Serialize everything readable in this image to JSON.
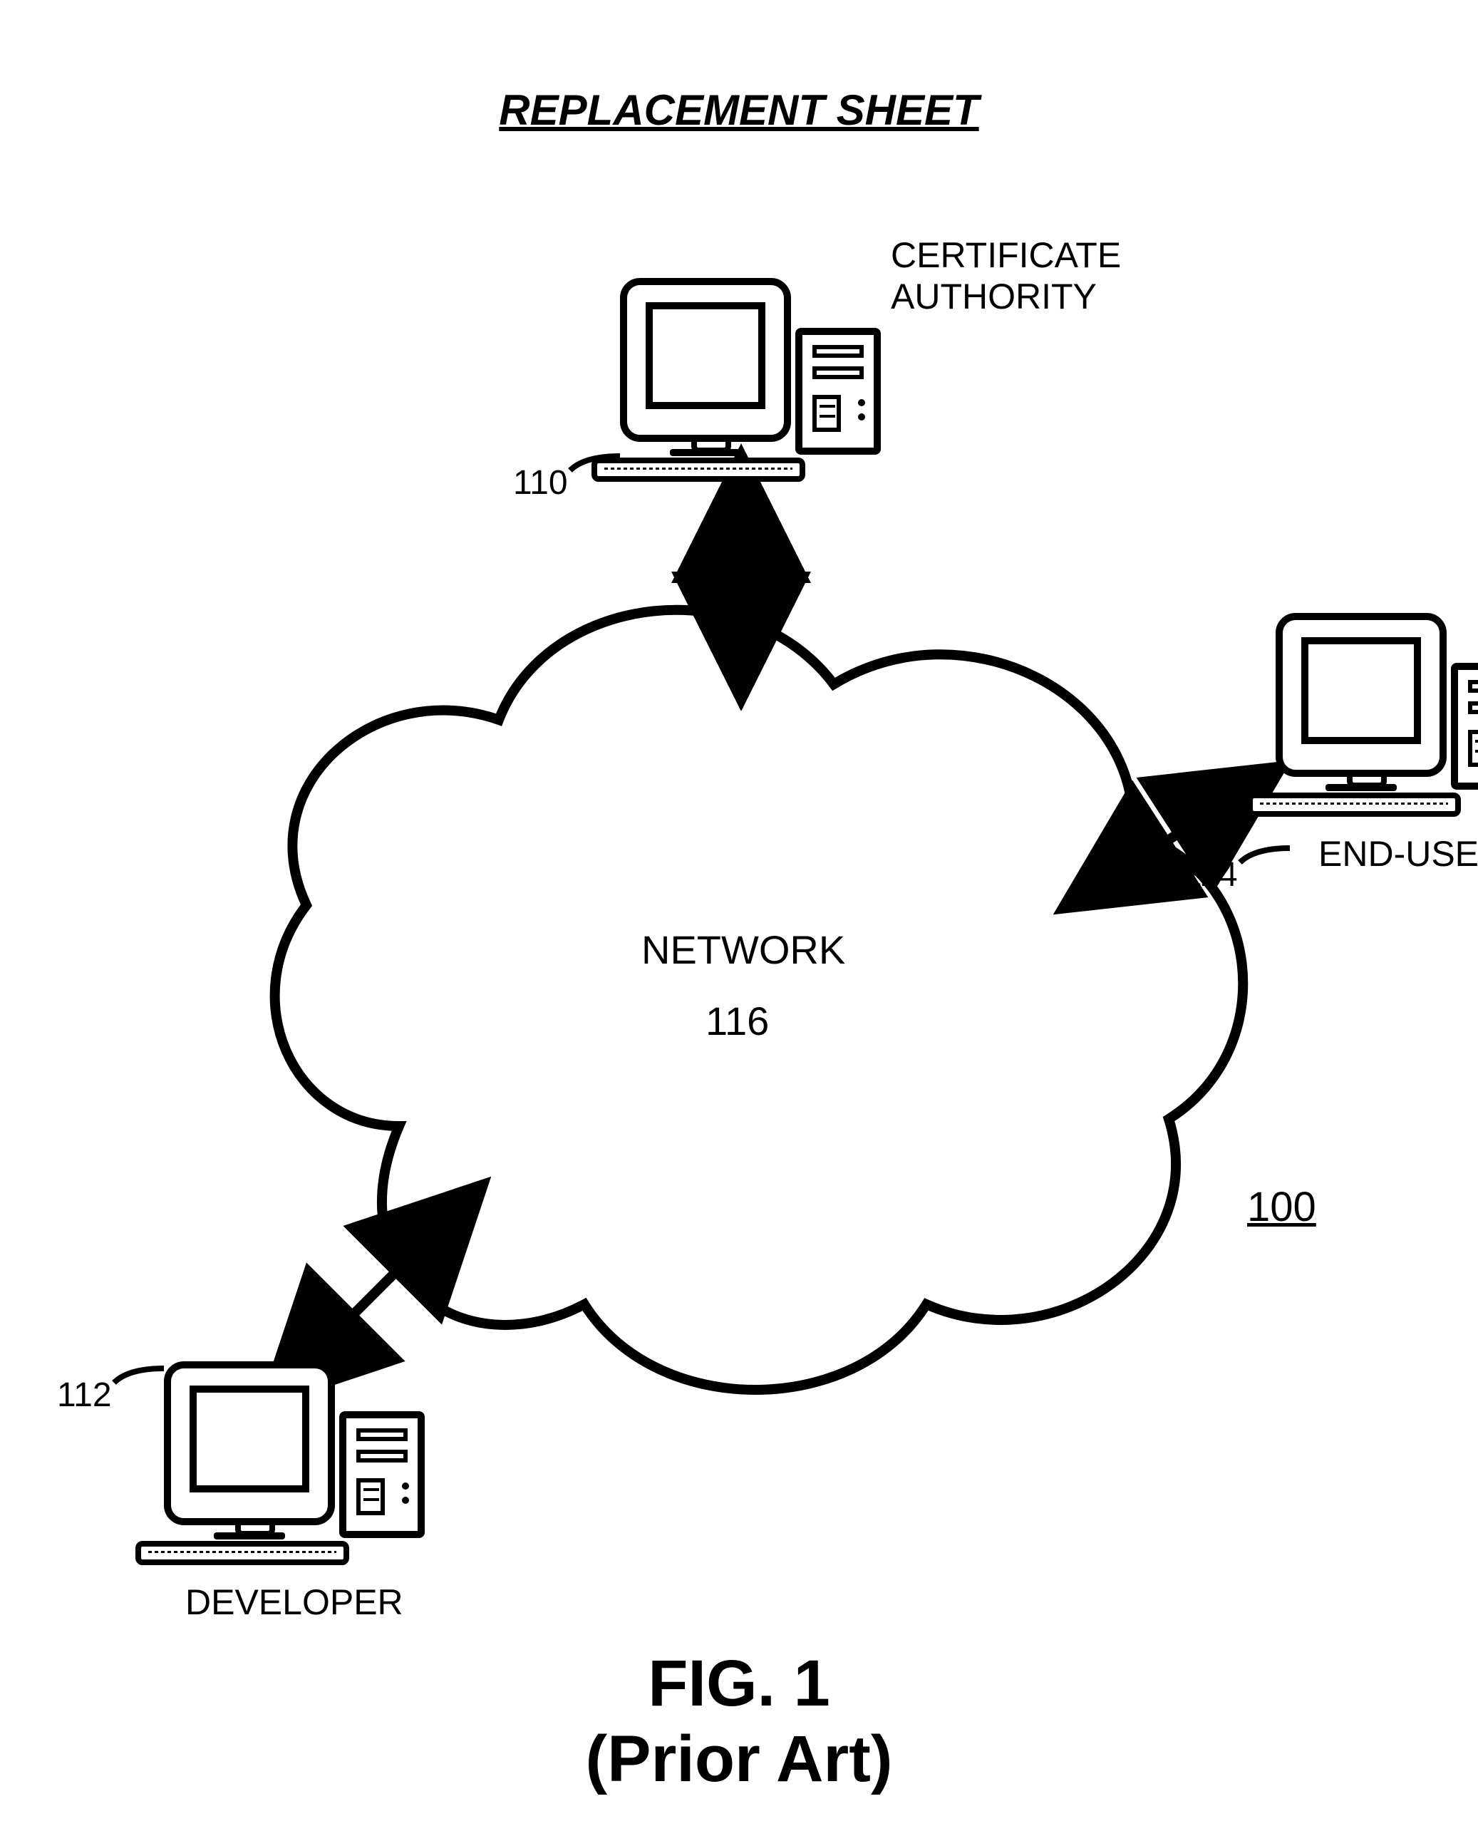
{
  "header": {
    "title": "REPLACEMENT SHEET"
  },
  "nodes": {
    "ca": {
      "label": "CERTIFICATE\nAUTHORITY",
      "ref": "110"
    },
    "dev": {
      "label": "DEVELOPER",
      "ref": "112"
    },
    "user": {
      "label": "END-USER",
      "ref": "114"
    },
    "net": {
      "label": "NETWORK",
      "ref": "116"
    }
  },
  "diagram_ref": "100",
  "figure": {
    "line1": "FIG. 1",
    "line2": "(Prior Art)"
  }
}
